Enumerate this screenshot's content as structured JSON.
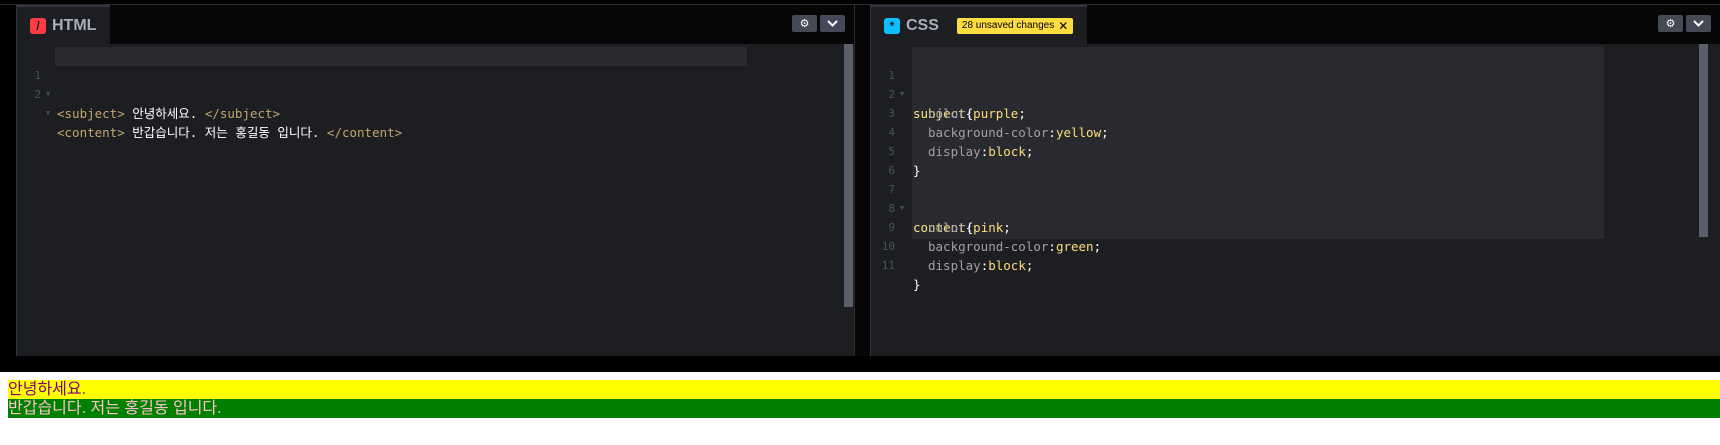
{
  "html_panel": {
    "title": "HTML",
    "icon": "html-slash-icon",
    "lines": [
      {
        "n": "1",
        "open": "<subject>",
        "text": " 안녕하세요. ",
        "close": "</subject>"
      },
      {
        "n": "2",
        "open": "<content>",
        "text": " 반갑습니다. 저는 홍길동 입니다. ",
        "close": "</content>"
      }
    ]
  },
  "css_panel": {
    "title": "CSS",
    "icon": "css-asterisk-icon",
    "unsaved_badge": "28 unsaved changes",
    "lines": [
      {
        "n": "1",
        "sel": "subject",
        "punc": "{"
      },
      {
        "n": "2",
        "prop": "color",
        "val": "purple"
      },
      {
        "n": "3",
        "prop": "background-color",
        "val": "yellow"
      },
      {
        "n": "4",
        "prop": "display",
        "val": "block"
      },
      {
        "n": "5",
        "punc": "}"
      },
      {
        "n": "6"
      },
      {
        "n": "7",
        "sel": "content",
        "punc": "{"
      },
      {
        "n": "8",
        "prop": "color",
        "val": "pink"
      },
      {
        "n": "9",
        "prop": "background-color",
        "val": "green"
      },
      {
        "n": "10",
        "prop": "display",
        "val": "block"
      },
      {
        "n": "11",
        "punc": "}"
      }
    ]
  },
  "header_buttons": {
    "settings_icon": "gear-icon",
    "collapse_icon": "chevron-down-icon"
  },
  "output": {
    "subject": "안녕하세요.",
    "content": "반갑습니다. 저는 홍길동 입니다."
  },
  "colors": {
    "editor_bg": "#1d1e22",
    "unsaved_badge": "#ffdd40",
    "html_icon": "#ff3c41",
    "css_icon": "#0ebeff"
  }
}
